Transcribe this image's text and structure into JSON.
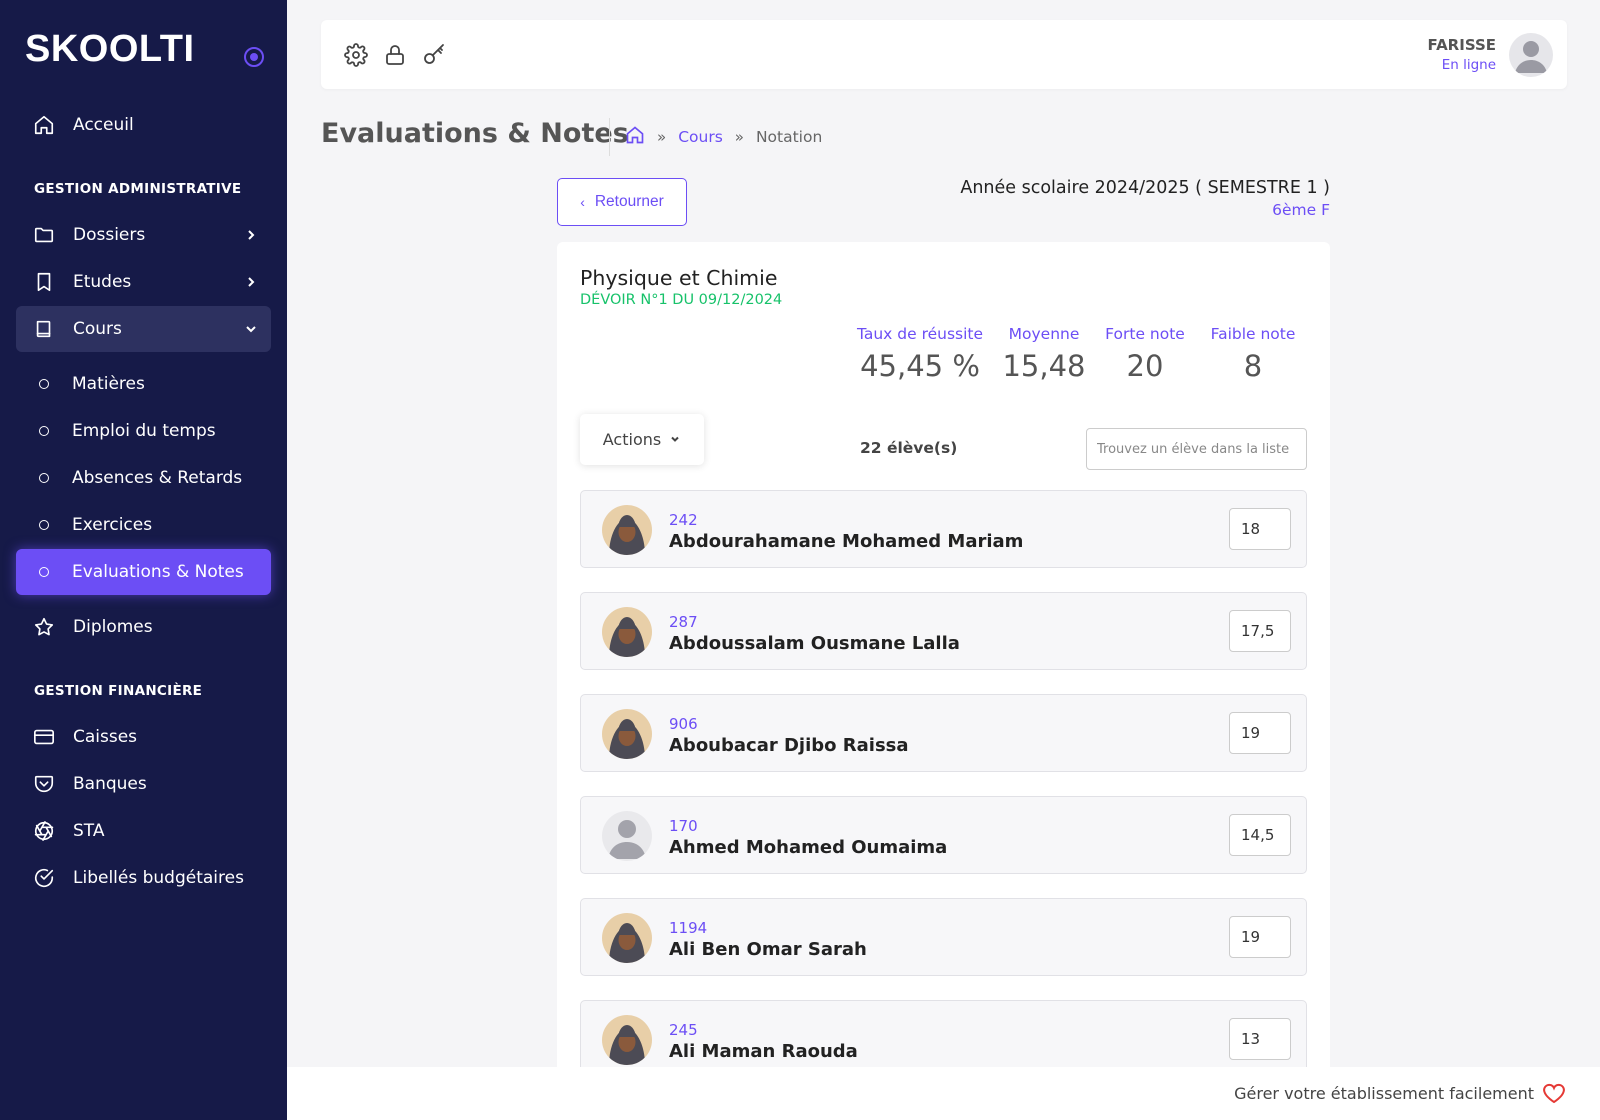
{
  "app": {
    "logo": "SKOOLTI"
  },
  "sidebar": {
    "home": "Acceuil",
    "section_admin": "GESTION ADMINISTRATIVE",
    "dossiers": "Dossiers",
    "etudes": "Etudes",
    "cours": "Cours",
    "sub": [
      "Matières",
      "Emploi du temps",
      "Absences & Retards",
      "Exercices",
      "Evaluations & Notes"
    ],
    "diplomes": "Diplomes",
    "section_fin": "GESTION FINANCIÈRE",
    "caisses": "Caisses",
    "banques": "Banques",
    "sta": "STA",
    "libelles": "Libellés budgétaires"
  },
  "header": {
    "icons": [
      "gear-icon",
      "lock-icon",
      "key-icon"
    ],
    "user_name": "FARISSE",
    "user_status": "En ligne"
  },
  "page": {
    "title": "Evaluations & Notes",
    "breadcrumb": {
      "link": "Cours",
      "current": "Notation"
    },
    "back_label": "Retourner",
    "year": "Année scolaire 2024/2025 ( SEMESTRE 1 )",
    "class": "6ème F"
  },
  "card": {
    "subject": "Physique et Chimie",
    "devoir": "DÉVOIR N°1 DU 09/12/2024",
    "stats": [
      {
        "label": "Taux de réussite",
        "value": "45,45 %"
      },
      {
        "label": "Moyenne",
        "value": "15,48"
      },
      {
        "label": "Forte note",
        "value": "20"
      },
      {
        "label": "Faible note",
        "value": "8"
      }
    ],
    "actions_label": "Actions",
    "count": "22 élève(s)",
    "search_placeholder": "Trouvez un élève dans la liste",
    "students": [
      {
        "num": "242",
        "name": "Abdourahamane Mohamed Mariam",
        "grade": "18",
        "photo": true
      },
      {
        "num": "287",
        "name": "Abdoussalam Ousmane Lalla",
        "grade": "17,5",
        "photo": true
      },
      {
        "num": "906",
        "name": "Aboubacar Djibo Raissa",
        "grade": "19",
        "photo": true
      },
      {
        "num": "170",
        "name": "Ahmed Mohamed Oumaima",
        "grade": "14,5",
        "photo": false
      },
      {
        "num": "1194",
        "name": "Ali Ben Omar Sarah",
        "grade": "19",
        "photo": true
      },
      {
        "num": "245",
        "name": "Ali Maman Raouda",
        "grade": "13",
        "photo": true
      }
    ]
  },
  "footer": {
    "text": "Gérer votre établissement facilement"
  },
  "colors": {
    "sidebar": "#161a48",
    "accent": "#6c4ef5",
    "success": "#17c26a",
    "heart": "#e53935"
  }
}
